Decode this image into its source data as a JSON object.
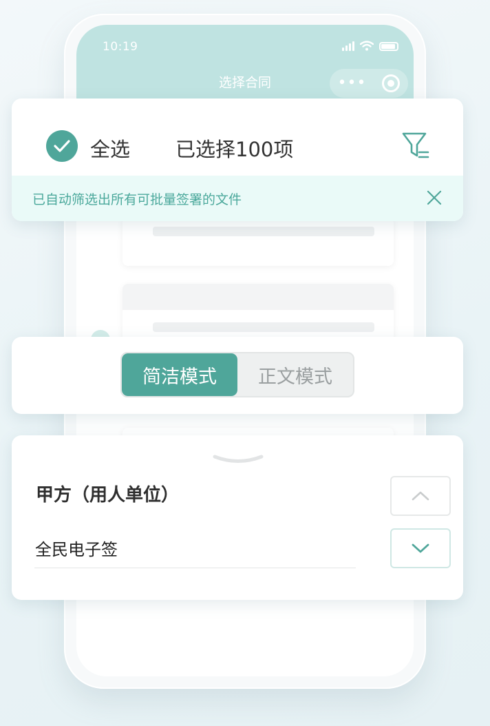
{
  "status_bar": {
    "time": "10:19"
  },
  "header": {
    "title": "选择合同",
    "capsule_more": "•••"
  },
  "selection": {
    "select_all_label": "全选",
    "selected_count": "已选择100项"
  },
  "notice": {
    "text": "已自动筛选出所有可批量签署的文件"
  },
  "mode_switch": {
    "options": [
      "简洁模式",
      "正文模式"
    ],
    "active": "简洁模式"
  },
  "party": {
    "title": "甲方（用人单位）",
    "value": "全民电子签"
  },
  "icons": {
    "check": "check-icon",
    "filter": "filter-icon",
    "close": "close-icon",
    "handle": "chevron-down-handle-icon",
    "up": "chevron-up-icon",
    "down": "chevron-down-icon"
  },
  "colors": {
    "accent": "#4fa69a",
    "header_bg": "#bfe3e1",
    "notice_bg": "#eafaf8"
  }
}
